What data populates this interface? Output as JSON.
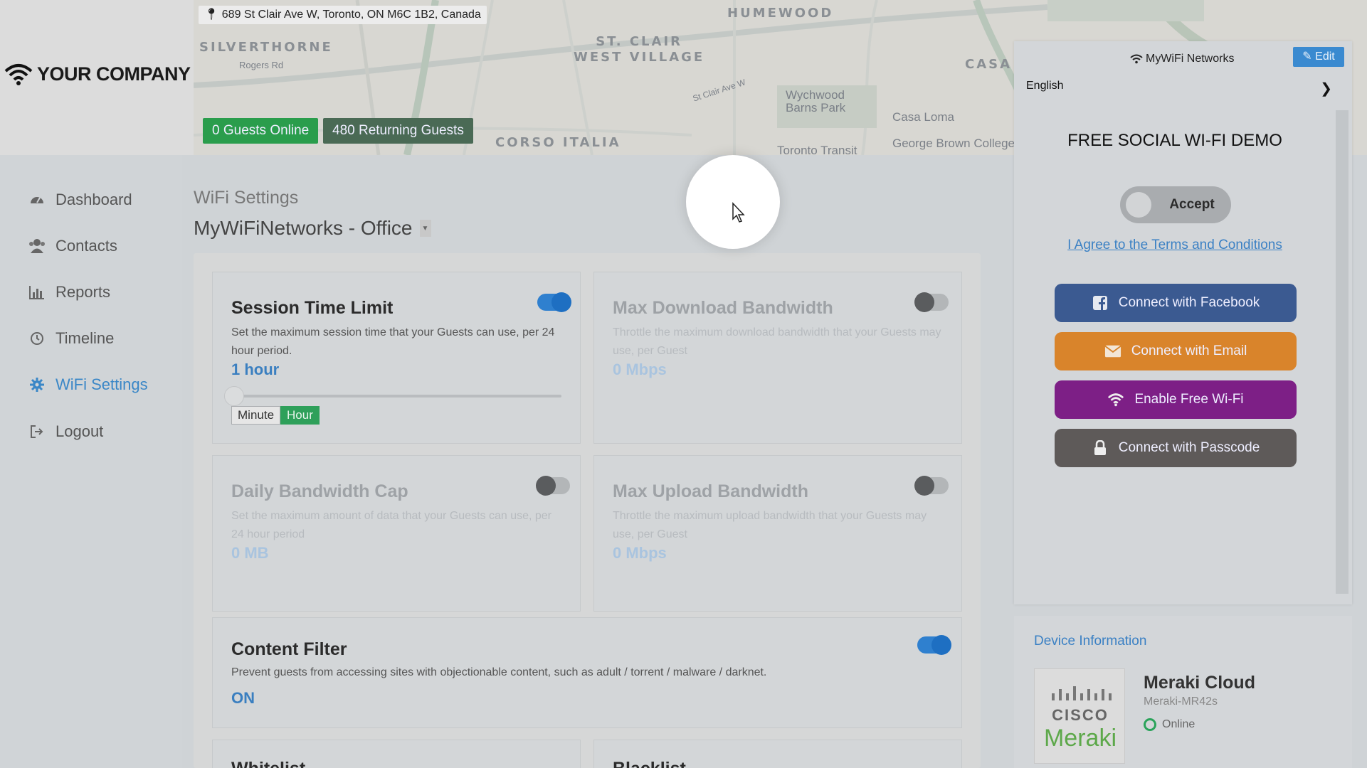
{
  "header": {
    "address": "689 St Clair Ave W, Toronto, ON M6C 1B2, Canada",
    "company": "YOUR COMPANY",
    "guests_online": "0 Guests Online",
    "returning_guests": "480 Returning Guests",
    "map_labels": {
      "humewood": "HUMEWOOD",
      "silverthorne": "SILVERTHORNE",
      "st_clair_1": "ST. CLAIR",
      "st_clair_2": "WEST VILLAGE",
      "casa": "CASA",
      "corso": "CORSO ITALIA",
      "wychwood_1": "Wychwood",
      "wychwood_2": "Barns Park",
      "casa_loma": "Casa Loma",
      "george_brown": "George Brown College",
      "toronto_transit": "Toronto Transit",
      "st_clair_ave": "St Clair Ave W",
      "rogers": "Rogers Rd"
    }
  },
  "sidebar": {
    "items": [
      {
        "label": "Dashboard",
        "icon": "dashboard-icon"
      },
      {
        "label": "Contacts",
        "icon": "users-icon"
      },
      {
        "label": "Reports",
        "icon": "bar-chart-icon"
      },
      {
        "label": "Timeline",
        "icon": "clock-icon"
      },
      {
        "label": "WiFi Settings",
        "icon": "gear-icon",
        "active": true
      },
      {
        "label": "Logout",
        "icon": "logout-icon"
      }
    ]
  },
  "main": {
    "section_title": "WiFi Settings",
    "network_name": "MyWiFiNetworks - Office",
    "cards": {
      "session": {
        "title": "Session Time Limit",
        "desc": "Set the maximum session time that your Guests can use, per 24 hour period.",
        "value": "1 hour",
        "enabled": true,
        "unit_minute": "Minute",
        "unit_hour": "Hour",
        "slider_fraction": 0
      },
      "download": {
        "title": "Max Download Bandwidth",
        "desc": "Throttle the maximum download bandwidth that your Guests may use, per Guest",
        "value": "0 Mbps",
        "enabled": false
      },
      "daily": {
        "title": "Daily Bandwidth Cap",
        "desc": "Set the maximum amount of data that your Guests can use, per 24 hour period",
        "value": "0 MB",
        "enabled": false
      },
      "upload": {
        "title": "Max Upload Bandwidth",
        "desc": "Throttle the maximum upload bandwidth that your Guests may use, per Guest",
        "value": "0 Mbps",
        "enabled": false
      },
      "content": {
        "title": "Content Filter",
        "desc": "Prevent guests from accessing sites with objectionable content, such as adult / torrent / malware / darknet.",
        "value": "ON",
        "enabled": true
      },
      "whitelist": {
        "title": "Whitelist"
      },
      "blacklist": {
        "title": "Blacklist"
      }
    }
  },
  "preview": {
    "brand": "MyWiFi Networks",
    "edit": "Edit",
    "language": "English",
    "title": "FREE SOCIAL WI-FI DEMO",
    "accept": "Accept",
    "terms": "I Agree to the Terms and Conditions",
    "buttons": [
      {
        "label": "Connect with Facebook",
        "color": "#3b5a91",
        "icon": "facebook-icon"
      },
      {
        "label": "Connect with Email",
        "color": "#d9842b",
        "icon": "envelope-icon"
      },
      {
        "label": "Enable Free Wi-Fi",
        "color": "#7d1f86",
        "icon": "wifi-icon"
      },
      {
        "label": "Connect with Passcode",
        "color": "#5e5a59",
        "icon": "lock-icon"
      }
    ]
  },
  "device": {
    "title": "Device Information",
    "name": "Meraki Cloud",
    "model": "Meraki-MR42s",
    "status": "Online",
    "logo_top": "CISCO",
    "logo_bottom": "Meraki"
  },
  "colors": {
    "accent": "#3a87c7",
    "toggle_on": "#2f80cf",
    "green": "#2a9d4c"
  }
}
